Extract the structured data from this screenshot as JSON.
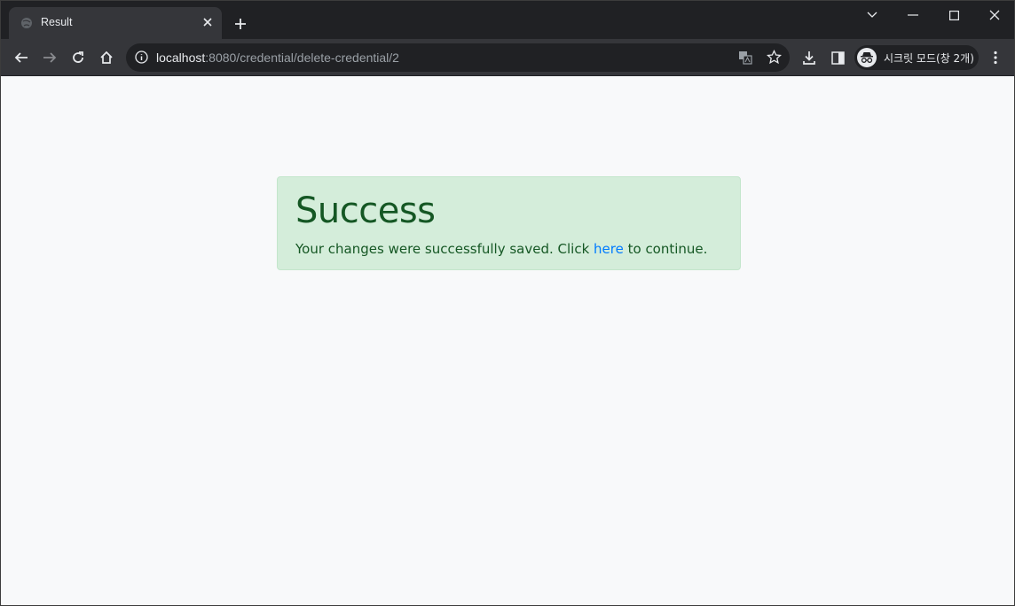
{
  "browser": {
    "tab": {
      "title": "Result"
    },
    "address_bar": {
      "host": "localhost",
      "path": ":8080/credential/delete-credential/2"
    },
    "profile": {
      "label": "시크릿 모드(창 2개)"
    }
  },
  "alert": {
    "heading": "Success",
    "text_before": "Your changes were successfully saved. Click ",
    "link_label": "here",
    "text_after": " to continue."
  },
  "colors": {
    "alert_bg": "#d4edda",
    "alert_text": "#155724",
    "link": "#007bff"
  }
}
